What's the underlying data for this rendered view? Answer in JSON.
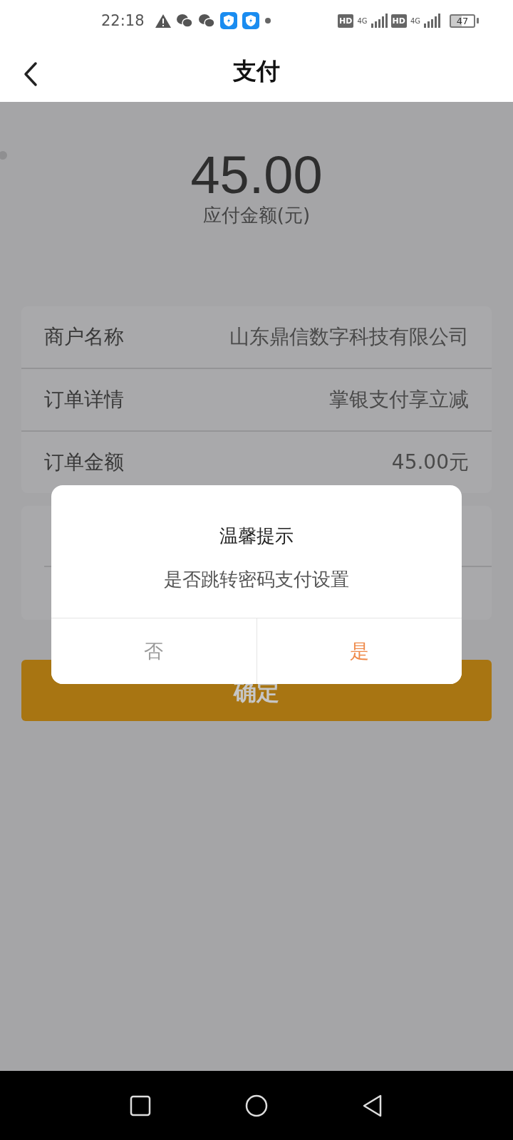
{
  "status_bar": {
    "time": "22:18",
    "hd_1": "HD",
    "network_1": "4G",
    "hd_2": "HD",
    "network_2": "4G",
    "battery": "47"
  },
  "header": {
    "title": "支付"
  },
  "amount": {
    "value": "45.00",
    "label": "应付金额(元)"
  },
  "order_details": [
    {
      "label": "商户名称",
      "value": "山东鼎信数字科技有限公司"
    },
    {
      "label": "订单详情",
      "value": "掌银支付享立减"
    },
    {
      "label": "订单金额",
      "value": "45.00元"
    }
  ],
  "confirm_button": {
    "label": "确定"
  },
  "dialog": {
    "title": "温馨提示",
    "message": "是否跳转密码支付设置",
    "buttons": [
      {
        "label": "否",
        "kind": "cancel"
      },
      {
        "label": "是",
        "kind": "confirm"
      }
    ]
  }
}
